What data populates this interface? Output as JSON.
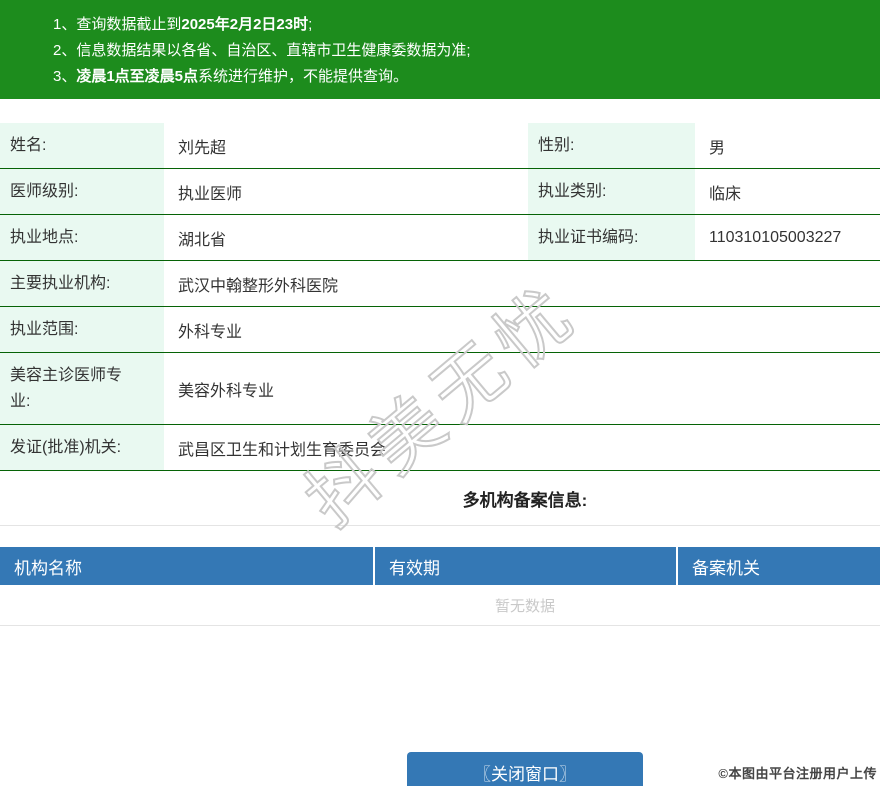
{
  "banner": {
    "lines": [
      {
        "num": "1、",
        "pre": "查询数据截止到",
        "bold": "2025年2月2日23时",
        "post": ";"
      },
      {
        "num": "2、",
        "pre": "信息数据结果以各省、自治区、直辖市卫生健康委数据为准;",
        "bold": "",
        "post": ""
      },
      {
        "num": "3、",
        "pre": "",
        "bold": "凌晨1点至凌晨5点",
        "post": "系统进行维护，不能提供查询。"
      }
    ]
  },
  "info_table": {
    "rows": [
      {
        "label": "姓名:",
        "value": "刘先超",
        "label2": "性别:",
        "value2": "男"
      },
      {
        "label": "医师级别:",
        "value": "执业医师",
        "label2": "执业类别:",
        "value2": "临床"
      },
      {
        "label": "执业地点:",
        "value": "湖北省",
        "label2": "执业证书编码:",
        "value2": "110310105003227"
      },
      {
        "label": "主要执业机构:",
        "value": "武汉中翰整形外科医院"
      },
      {
        "label": "执业范围:",
        "value": "外科专业"
      },
      {
        "label": "美容主诊医师专\n业:",
        "value": "美容外科专业"
      },
      {
        "label": "发证(批准)机关:",
        "value": "武昌区卫生和计划生育委员会"
      }
    ]
  },
  "multi_org": {
    "title": "多机构备案信息:",
    "headers": [
      "机构名称",
      "有效期",
      "备案机关"
    ],
    "empty_text": "暂无数据"
  },
  "close_button": {
    "label": "〖关闭窗口〗"
  },
  "watermarks": {
    "diagonal": "抖美无忧",
    "photo_credit": "©本图由平台注册用户上传"
  },
  "colors": {
    "banner_green": "#1d8c1d",
    "row_border_green": "#066306",
    "label_cell_mint": "#e9f9f1",
    "table_header_blue": "#3478b5",
    "button_blue": "#3478b5",
    "empty_text_gray": "#c9c9c9",
    "watermark_gray": "#c9c9c9"
  }
}
